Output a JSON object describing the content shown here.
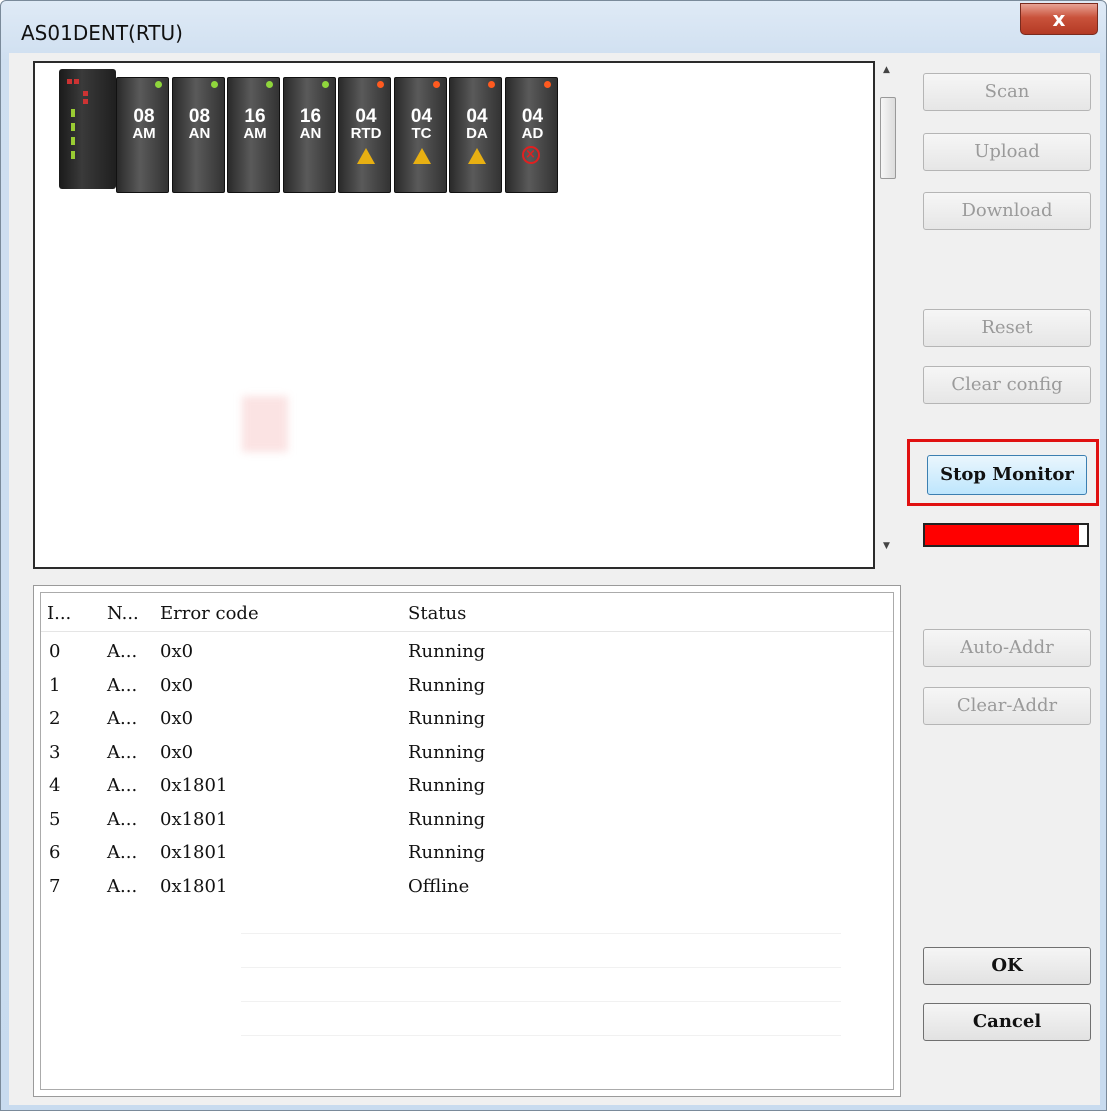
{
  "window": {
    "title": "AS01DENT(RTU)",
    "close_label": "x"
  },
  "modules": [
    {
      "top": "08",
      "bottom": "AM",
      "led": "green",
      "badge": ""
    },
    {
      "top": "08",
      "bottom": "AN",
      "led": "green",
      "badge": ""
    },
    {
      "top": "16",
      "bottom": "AM",
      "led": "green",
      "badge": ""
    },
    {
      "top": "16",
      "bottom": "AN",
      "led": "green",
      "badge": ""
    },
    {
      "top": "04",
      "bottom": "RTD",
      "led": "red",
      "badge": "warning"
    },
    {
      "top": "04",
      "bottom": "TC",
      "led": "red",
      "badge": "warning"
    },
    {
      "top": "04",
      "bottom": "DA",
      "led": "red",
      "badge": "warning"
    },
    {
      "top": "04",
      "bottom": "AD",
      "led": "red",
      "badge": "error"
    }
  ],
  "buttons": {
    "scan": "Scan",
    "upload": "Upload",
    "download": "Download",
    "reset": "Reset",
    "clear_config": "Clear config",
    "stop_monitor": "Stop Monitor",
    "auto_addr": "Auto-Addr",
    "clear_addr": "Clear-Addr",
    "ok": "OK",
    "cancel": "Cancel"
  },
  "progress": {
    "value": 0.95,
    "color": "#ff0000"
  },
  "table": {
    "columns": [
      "I...",
      "N...",
      "Error code",
      "Status"
    ],
    "rows": [
      [
        "0",
        "A...",
        "0x0",
        "Running"
      ],
      [
        "1",
        "A...",
        "0x0",
        "Running"
      ],
      [
        "2",
        "A...",
        "0x0",
        "Running"
      ],
      [
        "3",
        "A...",
        "0x0",
        "Running"
      ],
      [
        "4",
        "A...",
        "0x1801",
        "Running"
      ],
      [
        "5",
        "A...",
        "0x1801",
        "Running"
      ],
      [
        "6",
        "A...",
        "0x1801",
        "Running"
      ],
      [
        "7",
        "A...",
        "0x1801",
        "Offline"
      ]
    ]
  },
  "colors": {
    "highlight": "#e01010",
    "led_green": "#8fd63c",
    "led_red": "#ff5a1f",
    "warning": "#e8b012",
    "error": "#e02020"
  }
}
